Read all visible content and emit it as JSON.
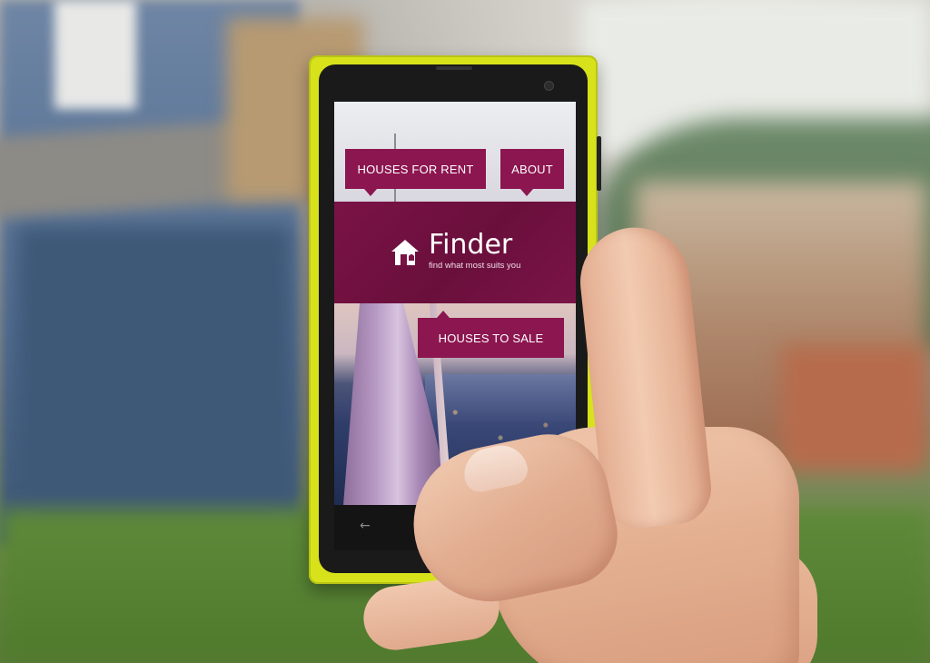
{
  "app": {
    "name": "Finder",
    "tagline": "find what most suits you"
  },
  "tiles": {
    "rent_label": "HOUSES FOR RENT",
    "about_label": "ABOUT",
    "sale_label": "HOUSES TO SALE"
  },
  "colors": {
    "brand": "#7a1346",
    "tile": "#8c1650",
    "phone_body": "#d7e21b"
  },
  "navbar": {
    "back_icon": "back-arrow-icon",
    "windows_icon": "windows-logo-icon"
  }
}
